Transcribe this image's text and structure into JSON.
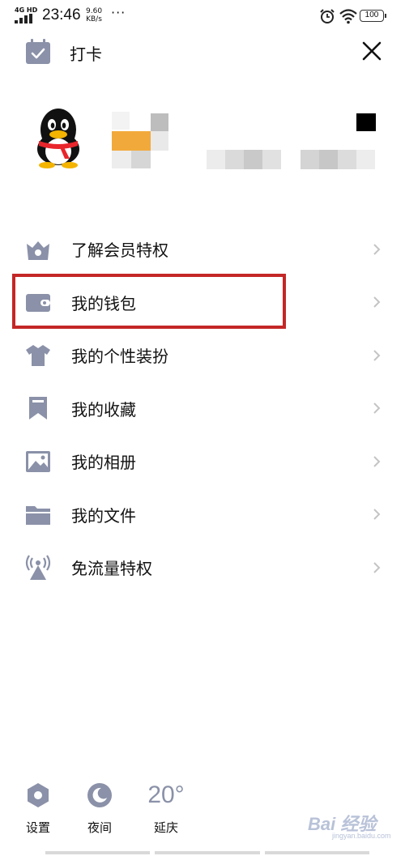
{
  "status_bar": {
    "network": "4G HD",
    "time": "23:46",
    "speed_value": "9.60",
    "speed_unit": "KB/s",
    "more": "···",
    "battery": "100"
  },
  "header": {
    "checkin_label": "打卡",
    "icon": "calendar-check-icon",
    "close_icon": "close-icon"
  },
  "menu": {
    "items": [
      {
        "label": "了解会员特权",
        "icon": "crown-icon"
      },
      {
        "label": "我的钱包",
        "icon": "wallet-icon"
      },
      {
        "label": "我的个性装扮",
        "icon": "tshirt-icon"
      },
      {
        "label": "我的收藏",
        "icon": "bookmark-icon"
      },
      {
        "label": "我的相册",
        "icon": "image-icon"
      },
      {
        "label": "我的文件",
        "icon": "folder-icon"
      },
      {
        "label": "免流量特权",
        "icon": "signal-tower-icon"
      }
    ],
    "highlighted_index": 1
  },
  "bottom": {
    "settings_label": "设置",
    "night_label": "夜间",
    "weather_temp": "20°",
    "weather_city": "延庆"
  },
  "watermark": {
    "text": "Bai 经验",
    "sub": "jingyan.baidu.com"
  },
  "colors": {
    "icon_gray": "#8a91a8",
    "highlight_red": "#c42727",
    "chevron": "#c4c4c4"
  }
}
